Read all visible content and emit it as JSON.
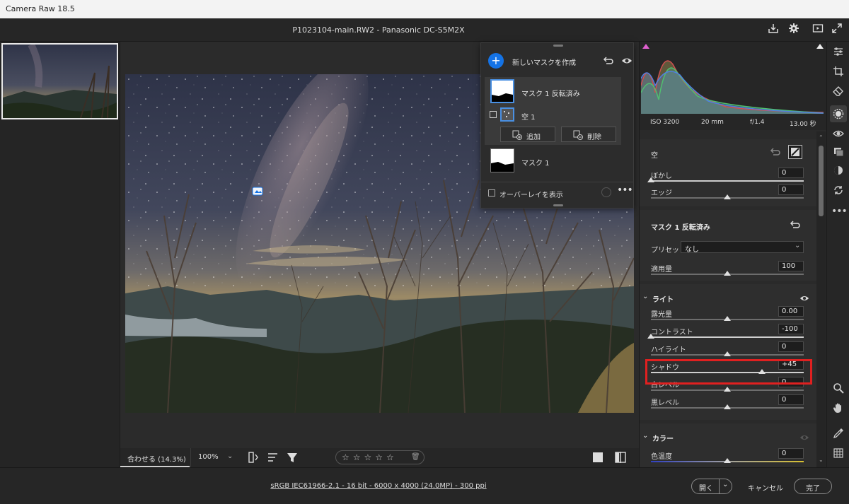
{
  "window": {
    "title": "Camera Raw 18.5"
  },
  "header": {
    "file_info": "P1023104-main.RW2  -  Panasonic DC-S5M2X"
  },
  "mask_panel": {
    "create_label": "新しいマスクを作成",
    "mask1_inverted_label": "マスク 1 反転済み",
    "sky_label": "空 1",
    "add_label": "追加",
    "subtract_label": "削除",
    "mask1_label": "マスク 1",
    "overlay_label": "オーバーレイを表示"
  },
  "histogram": {
    "iso": "ISO 3200",
    "focal": "20 mm",
    "aperture": "f/1.4",
    "shutter": "13.00 秒"
  },
  "sky_section": {
    "title": "空",
    "blur_label": "ぼかし",
    "blur_value": "0",
    "blur_level": 0.0,
    "edge_label": "エッジ",
    "edge_value": "0",
    "edge_level": 0.5
  },
  "mask_section": {
    "title": "マスク 1 反転済み",
    "preset_label": "プリセット",
    "preset_value": "なし",
    "amount_label": "適用量",
    "amount_value": "100",
    "amount_level": 0.5
  },
  "light_section": {
    "title": "ライト",
    "sliders": [
      {
        "label": "露光量",
        "value": "0.00",
        "level": 0.5
      },
      {
        "label": "コントラスト",
        "value": "-100",
        "level": 0.0
      },
      {
        "label": "ハイライト",
        "value": "0",
        "level": 0.5
      },
      {
        "label": "シャドウ",
        "value": "+45",
        "level": 0.725
      },
      {
        "label": "白レベル",
        "value": "0",
        "level": 0.5
      },
      {
        "label": "黒レベル",
        "value": "0",
        "level": 0.5
      }
    ]
  },
  "color_section": {
    "title": "カラー",
    "temp_label": "色温度",
    "temp_value": "0",
    "temp_level": 0.5
  },
  "bottom_tools": {
    "fit_label": "合わせる (14.3%)",
    "zoom_label": "100%"
  },
  "status": {
    "info_link": "sRGB IEC61966-2.1 - 16 bit - 6000 x 4000 (24.0MP) - 300 ppi",
    "open_label": "開く",
    "cancel_label": "キャンセル",
    "done_label": "完了"
  },
  "colors": {
    "accent": "#1473e6",
    "highlight": "#e02020"
  }
}
